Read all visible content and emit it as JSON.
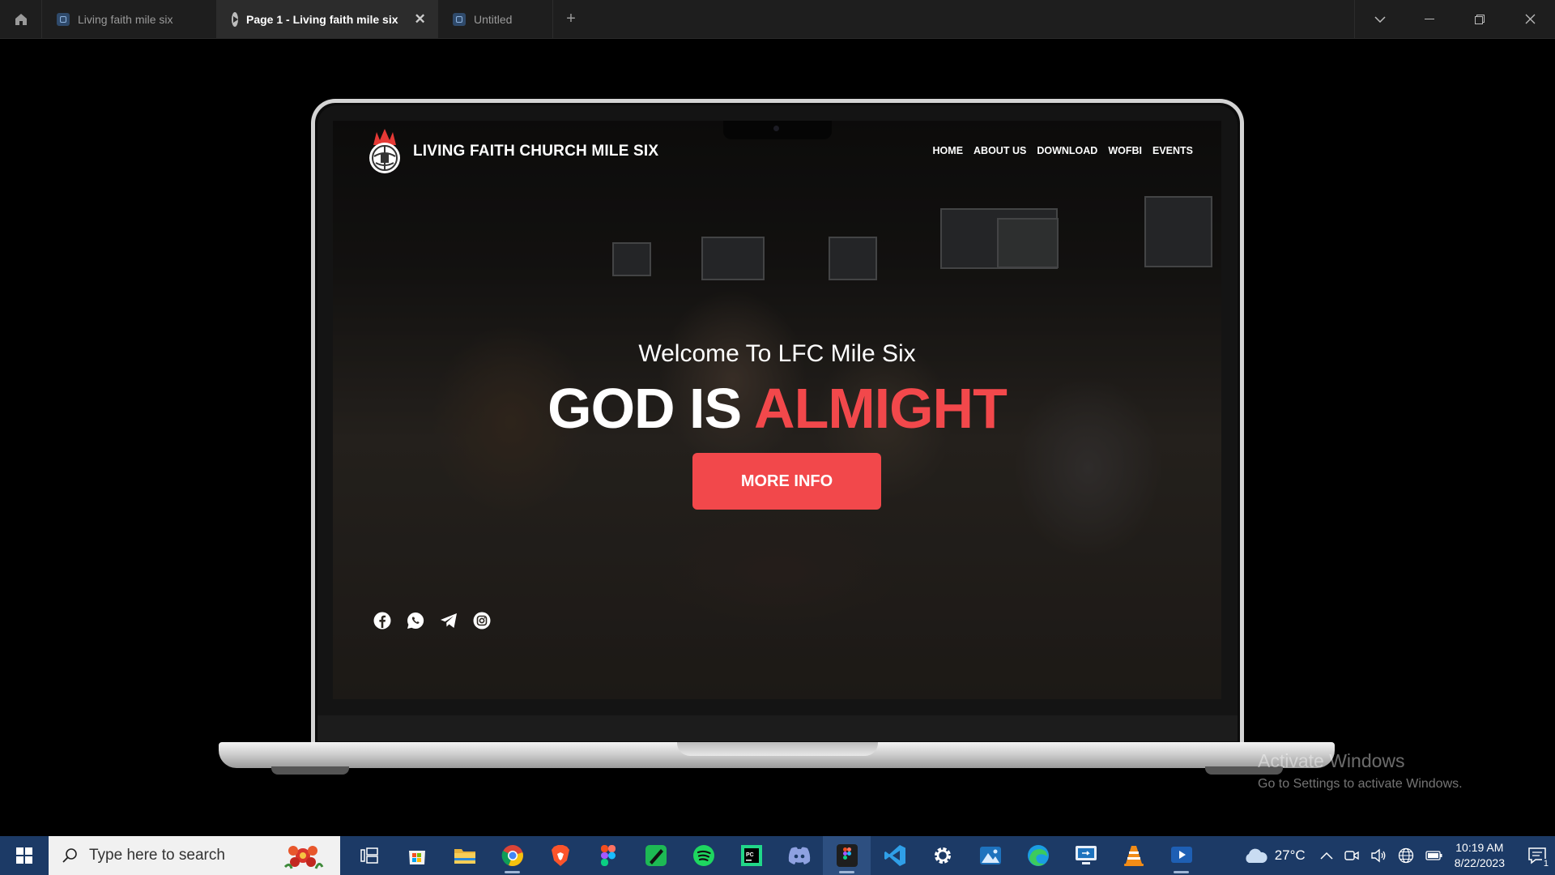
{
  "tabbar": {
    "tabs": [
      {
        "label": "Living faith mile six"
      },
      {
        "label": "Page 1 - Living faith mile six"
      },
      {
        "label": "Untitled"
      }
    ],
    "close_glyph": "✕",
    "new_tab_glyph": "+",
    "controls": {
      "dropdown": "⌄",
      "minimize": "—",
      "restore": "❐",
      "close": "✕"
    }
  },
  "site": {
    "name": "LIVING FAITH CHURCH MILE SIX",
    "nav": [
      "HOME",
      "ABOUT US",
      "DOWNLOAD",
      "WOFBI",
      "EVENTS"
    ],
    "welcome": "Welcome To LFC Mile Six",
    "headline_white": "GOD IS ",
    "headline_red": "ALMIGHT",
    "button_label": "MORE INFO",
    "social_icons": [
      "facebook-icon",
      "whatsapp-icon",
      "telegram-icon",
      "instagram-icon"
    ]
  },
  "watermark": {
    "title": "Activate Windows",
    "subtitle": "Go to Settings to activate Windows."
  },
  "taskbar": {
    "search_placeholder": "Type here to search",
    "apps": [
      "task-view",
      "microsoft-store",
      "file-explorer",
      "chrome",
      "brave",
      "figma",
      "pen-app",
      "spotify",
      "pycharm",
      "discord",
      "figma-active",
      "vscode",
      "settings",
      "photos",
      "edge",
      "remote-desktop",
      "vlc",
      "media-player"
    ],
    "weather": "27°C",
    "time": "10:19 AM",
    "date": "8/22/2023",
    "notification_count": "1"
  },
  "colors": {
    "accent_red": "#f2484b",
    "taskbar": "#1c3a66",
    "tabbar": "#1e1e1e"
  }
}
